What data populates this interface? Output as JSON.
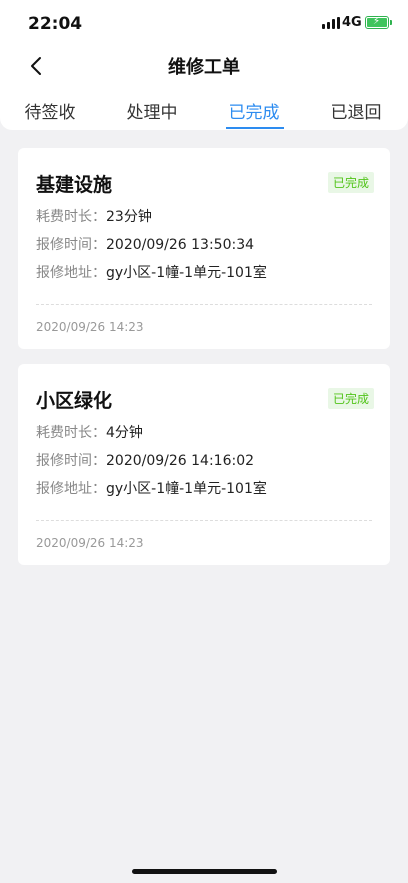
{
  "status_bar": {
    "time": "22:04",
    "network": "4G",
    "battery_level": 0.9,
    "battery_color": "#3ec45c"
  },
  "nav": {
    "title": "维修工单",
    "back_icon": "chevron-left-icon"
  },
  "tabs": {
    "items": [
      "待签收",
      "处理中",
      "已完成",
      "已退回"
    ],
    "active_index": 2,
    "active_color": "#2d8cf0"
  },
  "orders": [
    {
      "title": "基建设施",
      "status": "已完成",
      "duration_label": "耗费时长：",
      "duration": "23分钟",
      "report_time_label": "报修时间：",
      "report_time": "2020/09/26 13:50:34",
      "address_label": "报修地址：",
      "address": "gy小区-1幢-1单元-101室",
      "completed_time": "2020/09/26 14:23"
    },
    {
      "title": "小区绿化",
      "status": "已完成",
      "duration_label": "耗费时长：",
      "duration": "4分钟",
      "report_time_label": "报修时间：",
      "report_time": "2020/09/26 14:16:02",
      "address_label": "报修地址：",
      "address": "gy小区-1幢-1单元-101室",
      "completed_time": "2020/09/26 14:23"
    }
  ],
  "status_badge_color": "#52c41a"
}
